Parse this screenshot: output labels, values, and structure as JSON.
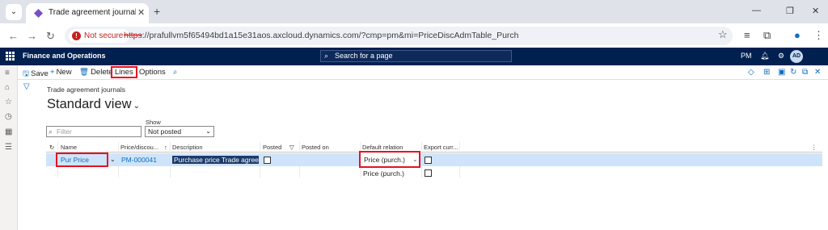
{
  "browser": {
    "tab_title": "Trade agreement journals -- Fin",
    "url_warning": "Not secure",
    "url_scheme": "https",
    "url_rest": "://prafullvm5f65494bd1a15e31aos.axcloud.dynamics.com/?cmp=pm&mi=PriceDiscAdmTable_Purch"
  },
  "appbar": {
    "app_name": "Finance and Operations",
    "search_placeholder": "Search for a page",
    "company": "PM",
    "avatar_initials": "AD"
  },
  "actions": {
    "save": "Save",
    "new": "New",
    "delete": "Delete",
    "lines": "Lines",
    "options": "Options"
  },
  "page": {
    "breadcrumb": "Trade agreement journals",
    "view_title": "Standard view",
    "filter_placeholder": "Filter",
    "show_label": "Show",
    "show_value": "Not posted"
  },
  "grid": {
    "columns": [
      "Name",
      "Price/discou...",
      "Description",
      "Posted",
      "Posted on",
      "Default relation",
      "Export curr..."
    ],
    "rows": [
      {
        "name": "Pur Price",
        "journal": "PM-000041",
        "description": "Purchase price Trade agreement",
        "posted": false,
        "posted_on": "",
        "default_relation": "Price (purch.)",
        "export_currency": false
      }
    ],
    "dropdown_option": "Price (purch.)"
  }
}
